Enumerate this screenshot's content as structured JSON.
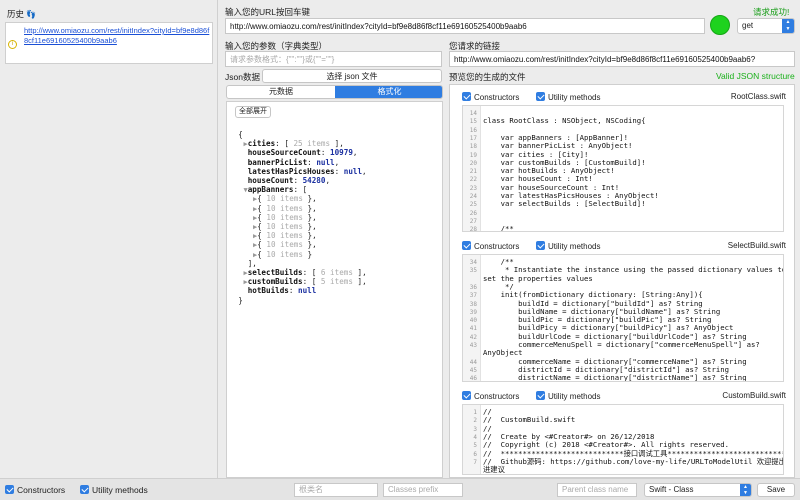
{
  "history": {
    "title": "历史",
    "entry_url": "http://www.omiaozu.com/rest/initIndex?cityId=bf9e8d86f8cf11e69160525400b9aab6"
  },
  "url_section": {
    "label": "输入您的URL按回车键",
    "url_value": "http://www.omiaozu.com/rest/initIndex?cityId=bf9e8d86f8cf11e69160525400b9aab6",
    "status": "请求成功!",
    "status_color": "#1a9e1a",
    "indicator_color": "#1ed21e",
    "method": "get",
    "method_options": [
      "get"
    ]
  },
  "params": {
    "label": "输入您的参数（字典类型）",
    "placeholder": "请求参数格式：{\"\":\"\"}或{\"\"=\"\"}"
  },
  "request_link": {
    "label": "您请求的链接",
    "value": "http://www.omiaozu.com/rest/initIndex?cityId=bf9e8d86f8cf11e69160525400b9aab6?"
  },
  "json_panel": {
    "label": "Json数据",
    "select_button": "选择 json 文件",
    "tabs": [
      {
        "label": "元数据",
        "active": false
      },
      {
        "label": "格式化",
        "active": true
      }
    ],
    "expand_all": "全部展开",
    "tree": [
      {
        "indent": 0,
        "tri": "",
        "text": "{"
      },
      {
        "indent": 1,
        "tri": "▶",
        "key": "cities",
        "collapsed": "25 items",
        "suffix": ","
      },
      {
        "indent": 1,
        "tri": "",
        "key": "houseSourceCount",
        "num": "10979",
        "suffix": ","
      },
      {
        "indent": 1,
        "tri": "",
        "key": "bannerPicList",
        "nul": "null",
        "suffix": ","
      },
      {
        "indent": 1,
        "tri": "",
        "key": "latestHasPicsHouses",
        "nul": "null",
        "suffix": ","
      },
      {
        "indent": 1,
        "tri": "",
        "key": "houseCount",
        "num": "54280",
        "suffix": ","
      },
      {
        "indent": 1,
        "tri": "▼",
        "key": "appBanners",
        "open": "["
      },
      {
        "indent": 2,
        "tri": "▶",
        "obj": "{",
        "collapsed": "10 items",
        "suffix": "},"
      },
      {
        "indent": 2,
        "tri": "▶",
        "obj": "{",
        "collapsed": "10 items",
        "suffix": "},"
      },
      {
        "indent": 2,
        "tri": "▶",
        "obj": "{",
        "collapsed": "10 items",
        "suffix": "},"
      },
      {
        "indent": 2,
        "tri": "▶",
        "obj": "{",
        "collapsed": "10 items",
        "suffix": "},"
      },
      {
        "indent": 2,
        "tri": "▶",
        "obj": "{",
        "collapsed": "10 items",
        "suffix": "},"
      },
      {
        "indent": 2,
        "tri": "▶",
        "obj": "{",
        "collapsed": "10 items",
        "suffix": "},"
      },
      {
        "indent": 2,
        "tri": "▶",
        "obj": "{",
        "collapsed": "10 items",
        "suffix": "}"
      },
      {
        "indent": 1,
        "tri": "",
        "text": "],"
      },
      {
        "indent": 1,
        "tri": "▶",
        "key": "selectBuilds",
        "collapsed": "6 items",
        "suffix": ","
      },
      {
        "indent": 1,
        "tri": "▶",
        "key": "customBuilds",
        "collapsed": "5 items",
        "suffix": ","
      },
      {
        "indent": 1,
        "tri": "",
        "key": "hotBuilds",
        "nul": "null",
        "suffix": ""
      },
      {
        "indent": 0,
        "tri": "",
        "text": "}"
      }
    ]
  },
  "preview": {
    "label": "预览您的生成的文件",
    "valid_label": "Valid JSON structure",
    "valid_color": "#1ab01a",
    "files": [
      {
        "constructors": "Constructors",
        "utility": "Utility methods",
        "filename": "RootClass.swift",
        "lines": [
          {
            "n": "14",
            "t": ""
          },
          {
            "n": "15",
            "t": "class RootClass : NSObject, NSCoding{"
          },
          {
            "n": "16",
            "t": ""
          },
          {
            "n": "17",
            "t": "    var appBanners : [AppBanner]!"
          },
          {
            "n": "18",
            "t": "    var bannerPicList : AnyObject!"
          },
          {
            "n": "19",
            "t": "    var cities : [City]!"
          },
          {
            "n": "20",
            "t": "    var customBuilds : [CustomBuild]!"
          },
          {
            "n": "21",
            "t": "    var hotBuilds : AnyObject!"
          },
          {
            "n": "22",
            "t": "    var houseCount : Int!"
          },
          {
            "n": "23",
            "t": "    var houseSourceCount : Int!"
          },
          {
            "n": "24",
            "t": "    var latestHasPicsHouses : AnyObject!"
          },
          {
            "n": "25",
            "t": "    var selectBuilds : [SelectBuild]!"
          },
          {
            "n": "26",
            "t": ""
          },
          {
            "n": "27",
            "t": ""
          },
          {
            "n": "28",
            "t": "    /**"
          },
          {
            "n": "29",
            "t": "     * Instantiate the instance using the passed dictionary values to"
          }
        ]
      },
      {
        "constructors": "Constructors",
        "utility": "Utility methods",
        "filename": "SelectBuild.swift",
        "lines": [
          {
            "n": "34",
            "t": "    /**"
          },
          {
            "n": "35",
            "t": "     * Instantiate the instance using the passed dictionary values to"
          },
          {
            "n": "",
            "t": "set the properties values"
          },
          {
            "n": "36",
            "t": "     */"
          },
          {
            "n": "37",
            "t": "    init(fromDictionary dictionary: [String:Any]){"
          },
          {
            "n": "38",
            "t": "        buildId = dictionary[\"buildId\"] as? String"
          },
          {
            "n": "39",
            "t": "        buildName = dictionary[\"buildName\"] as? String"
          },
          {
            "n": "40",
            "t": "        buildPic = dictionary[\"buildPic\"] as? String"
          },
          {
            "n": "41",
            "t": "        buildPicy = dictionary[\"buildPicy\"] as? AnyObject"
          },
          {
            "n": "42",
            "t": "        buildUrlCode = dictionary[\"buildUrlCode\"] as? String"
          },
          {
            "n": "43",
            "t": "        commerceMenuSpell = dictionary[\"commerceMenuSpell\"] as?"
          },
          {
            "n": "",
            "t": "AnyObject"
          },
          {
            "n": "44",
            "t": "        commerceName = dictionary[\"commerceName\"] as? String"
          },
          {
            "n": "45",
            "t": "        districtId = dictionary[\"districtId\"] as? String"
          },
          {
            "n": "46",
            "t": "        districtName = dictionary[\"districtName\"] as? String"
          },
          {
            "n": "47",
            "t": "        districtUrlCode = dictionary[\"districtUrlCode\"] as? AnyObject"
          }
        ]
      },
      {
        "constructors": "Constructors",
        "utility": "Utility methods",
        "filename": "CustomBuild.swift",
        "lines": [
          {
            "n": "1",
            "t": "//"
          },
          {
            "n": "2",
            "t": "//  CustomBuild.swift"
          },
          {
            "n": "3",
            "t": "//"
          },
          {
            "n": "4",
            "t": "//  Create by <#Creator#> on 26/12/2018"
          },
          {
            "n": "5",
            "t": "//  Copyright (c) 2018 <#Creator#>. All rights reserved."
          },
          {
            "n": "6",
            "t": "//  ****************************接口调试工具****************************"
          },
          {
            "n": "7",
            "t": "//  Github源码: https://github.com/love-my-life/URLToModelUtil 欢迎提出改"
          },
          {
            "n": "",
            "t": "进建议"
          }
        ]
      }
    ]
  },
  "bottom_bar": {
    "constructors": "Constructors",
    "utility": "Utility methods",
    "class_name_placeholder": "根类名",
    "prefix_placeholder": "Classes prefix",
    "parent_placeholder": "Parent class name",
    "language": "Swift - Class",
    "save": "Save"
  }
}
